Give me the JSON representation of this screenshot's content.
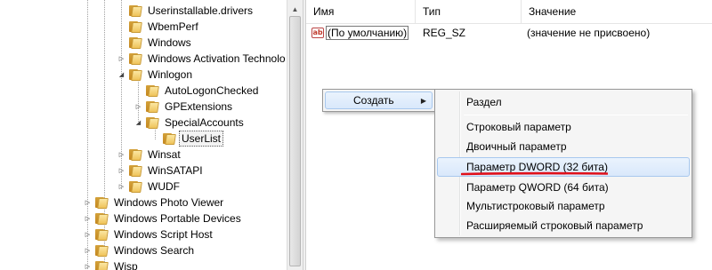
{
  "tree": {
    "items": [
      {
        "label": "Userinstallable.drivers",
        "expander": ""
      },
      {
        "label": "WbemPerf",
        "expander": ""
      },
      {
        "label": "Windows",
        "expander": ""
      },
      {
        "label": "Windows Activation Technolo",
        "expander": "▷"
      },
      {
        "label": "Winlogon",
        "expander": "◢"
      },
      {
        "label": "AutoLogonChecked",
        "expander": ""
      },
      {
        "label": "GPExtensions",
        "expander": "▷"
      },
      {
        "label": "SpecialAccounts",
        "expander": "◢"
      },
      {
        "label": "UserList",
        "expander": ""
      },
      {
        "label": "Winsat",
        "expander": "▷"
      },
      {
        "label": "WinSATAPI",
        "expander": "▷"
      },
      {
        "label": "WUDF",
        "expander": "▷"
      },
      {
        "label": "Windows Photo Viewer",
        "expander": "▷"
      },
      {
        "label": "Windows Portable Devices",
        "expander": "▷"
      },
      {
        "label": "Windows Script Host",
        "expander": "▷"
      },
      {
        "label": "Windows Search",
        "expander": "▷"
      },
      {
        "label": "Wisp",
        "expander": "▷"
      }
    ],
    "scroll_up_icon": "▲"
  },
  "list": {
    "columns": {
      "name": "Имя",
      "type": "Тип",
      "value": "Значение"
    },
    "rows": [
      {
        "icon": "ab",
        "name": "(По умолчанию)",
        "type": "REG_SZ",
        "value": "(значение не присвоено)"
      }
    ]
  },
  "context_menu": {
    "create_label": "Создать",
    "submenu_arrow": "▶",
    "submenu": [
      "Раздел",
      "Строковый параметр",
      "Двоичный параметр",
      "Параметр DWORD (32 бита)",
      "Параметр QWORD (64 бита)",
      "Мультистроковый параметр",
      "Расширяемый строковый параметр"
    ]
  },
  "colors": {
    "highlight": "#d9e8fb",
    "underline": "#e0101a"
  }
}
